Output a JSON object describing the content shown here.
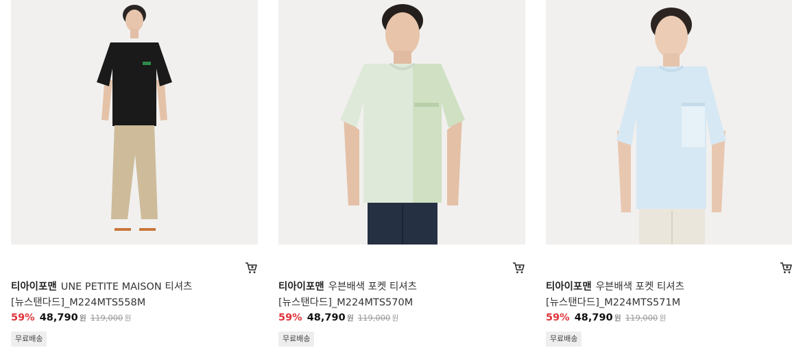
{
  "products": [
    {
      "image_alt": "model wearing black tee with beige cargo pants",
      "brand": "티아이포맨",
      "name": "UNE PETITE MAISON 티셔츠[뉴스탠다드]_M224MTS558M",
      "discount_rate": "59%",
      "sale_price": "48,790",
      "sale_currency": "원",
      "original_price": "119,000",
      "original_currency": "원",
      "badge": "무료배송",
      "colors": {
        "shirt": "#1a1a1a",
        "pocket": "#1a1a1a",
        "pants": "#cdbb9a"
      }
    },
    {
      "image_alt": "model wearing mint color-block pocket tee with navy slacks",
      "brand": "티아이포맨",
      "name": "우븐배색 포켓 티셔츠[뉴스탠다드]_M224MTS570M",
      "discount_rate": "59%",
      "sale_price": "48,790",
      "sale_currency": "원",
      "original_price": "119,000",
      "original_currency": "원",
      "badge": "무료배송",
      "colors": {
        "shirt": "#dfe9da",
        "pocket": "#cfe0c3",
        "pants": "#263043"
      }
    },
    {
      "image_alt": "model wearing light blue pocket tee with cream pants",
      "brand": "티아이포맨",
      "name": "우븐배색 포켓 티셔츠[뉴스탠다드]_M224MTS571M",
      "discount_rate": "59%",
      "sale_price": "48,790",
      "sale_currency": "원",
      "original_price": "119,000",
      "original_currency": "원",
      "badge": "무료배송",
      "colors": {
        "shirt": "#d6e8f3",
        "pocket": "#e6f1f8",
        "pants": "#ebe6dc"
      }
    }
  ]
}
